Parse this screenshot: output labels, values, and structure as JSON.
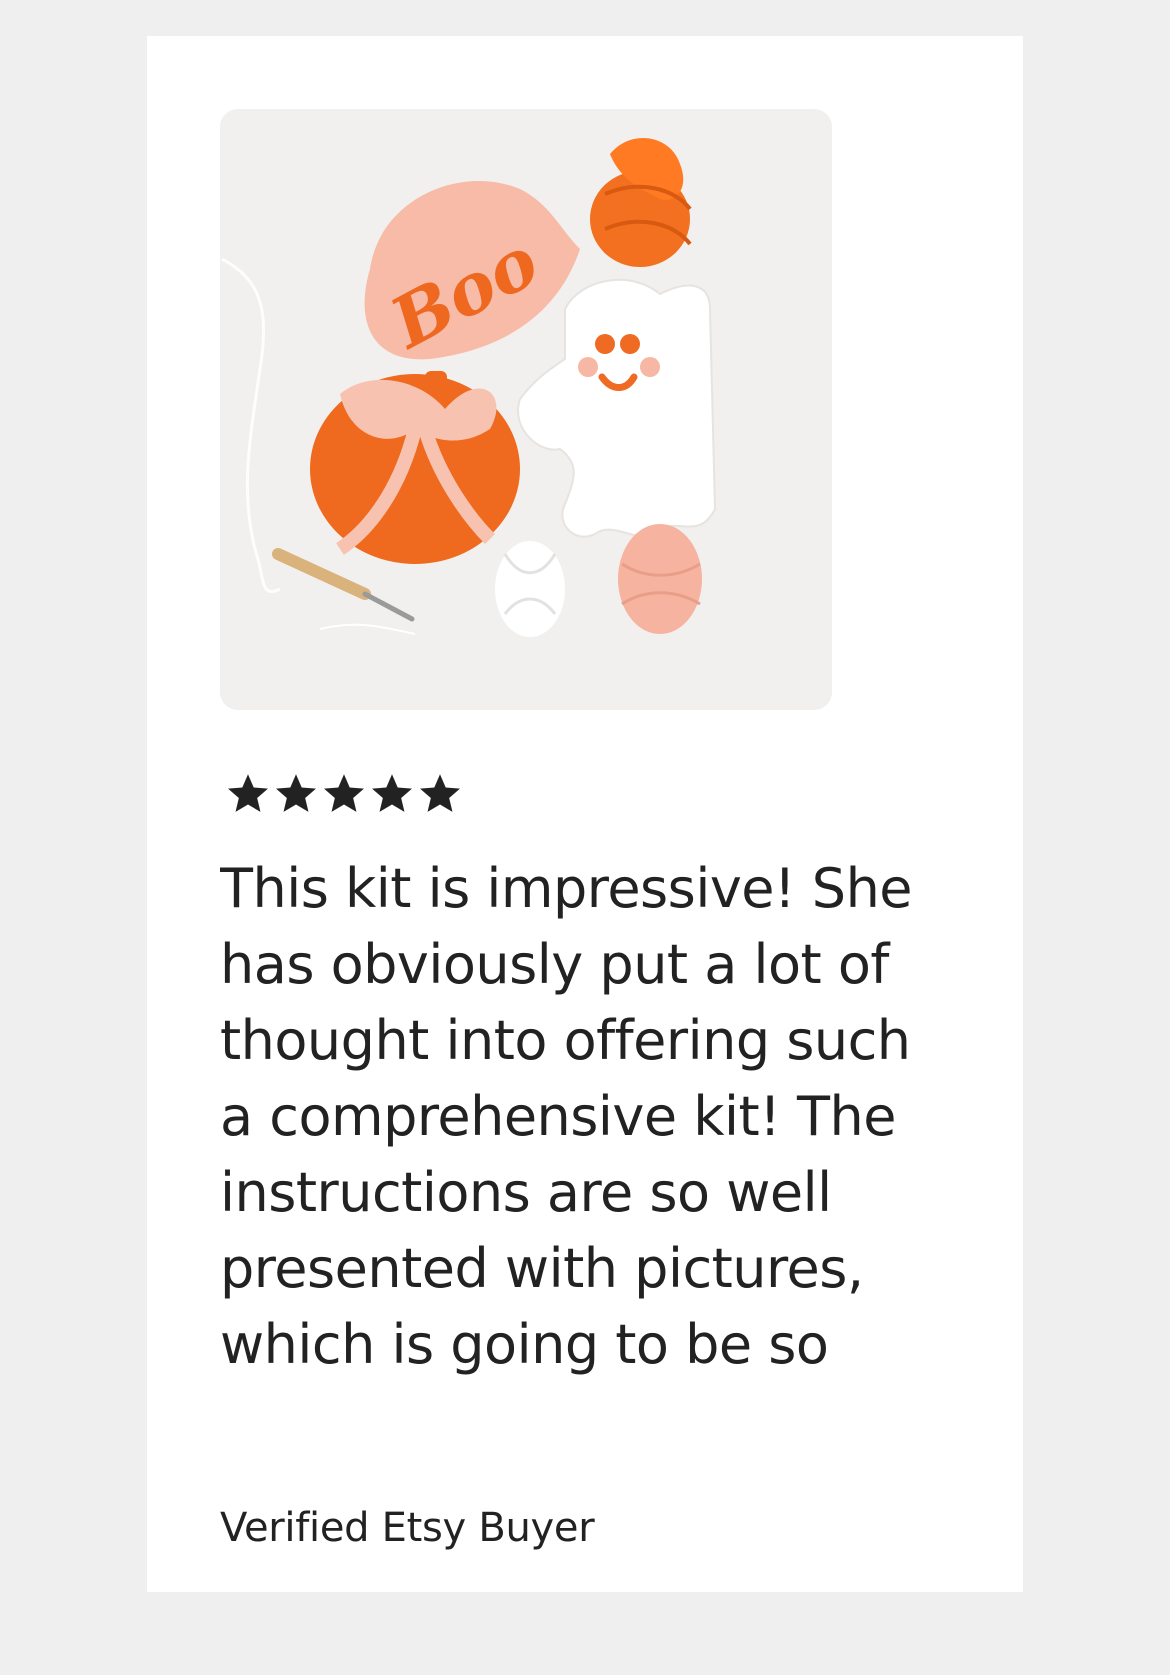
{
  "review": {
    "rating": 5,
    "rating_max": 5,
    "star_icon": "star-icon",
    "photo_subject": "punch-needle-kit-photo",
    "text": "This kit is impressive! She has obviously put a lot of thought into offering such a comprehensive kit! The instructions are so well presented with pictures, which is going to be so",
    "author": "Verified Etsy Buyer"
  },
  "colors": {
    "page_bg": "#efefef",
    "card_bg": "#ffffff",
    "text": "#222222",
    "orange": "#f06a1e",
    "peach": "#f7b8a4"
  }
}
